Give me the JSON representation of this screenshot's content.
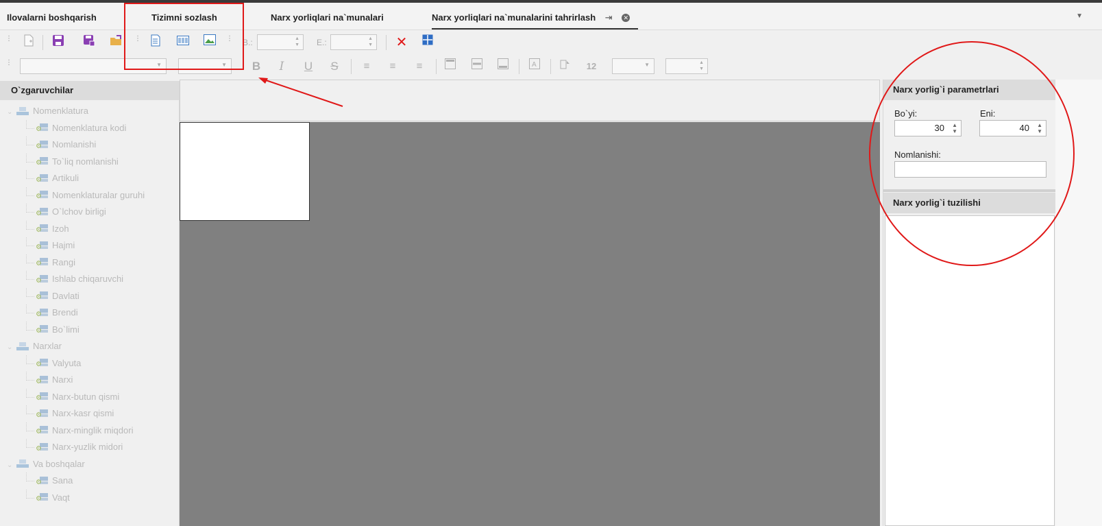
{
  "tabs": [
    {
      "label": "Ilovalarni boshqarish",
      "active": false
    },
    {
      "label": "Tizimni sozlash",
      "active": false
    },
    {
      "label": "Narx yorliqlari na`munalari",
      "active": false
    },
    {
      "label": "Narx yorliqlari na`munalarini tahrirlash",
      "active": true
    }
  ],
  "toolbar": {
    "b_label": "B.:",
    "e_label": "E.:",
    "size_label": "12"
  },
  "left_panel": {
    "title": "O`zgaruvchilar",
    "groups": [
      {
        "label": "Nomenklatura",
        "items": [
          "Nomenklatura kodi",
          "Nomlanishi",
          "To`liq nomlanishi",
          "Artikuli",
          "Nomenklaturalar guruhi",
          "O`lchov birligi",
          "Izoh",
          "Hajmi",
          "Rangi",
          "Ishlab chiqaruvchi",
          "Davlati",
          "Brendi",
          "Bo`limi"
        ]
      },
      {
        "label": "Narxlar",
        "items": [
          "Valyuta",
          "Narxi",
          "Narx-butun qismi",
          "Narx-kasr qismi",
          "Narx-minglik miqdori",
          "Narx-yuzlik midori"
        ]
      },
      {
        "label": "Va boshqalar",
        "items": [
          "Sana",
          "Vaqt"
        ]
      }
    ]
  },
  "right_panel": {
    "params_title": "Narx yorlig`i parametrlari",
    "height_label": "Bo`yi:",
    "height_value": "30",
    "width_label": "Eni:",
    "width_value": "40",
    "name_label": "Nomlanishi:",
    "name_value": "",
    "structure_title": "Narx yorlig`i tuzilishi"
  },
  "colors": {
    "annotation": "#e01818",
    "canvas": "#808080",
    "accent_purple": "#8a3fb3"
  }
}
